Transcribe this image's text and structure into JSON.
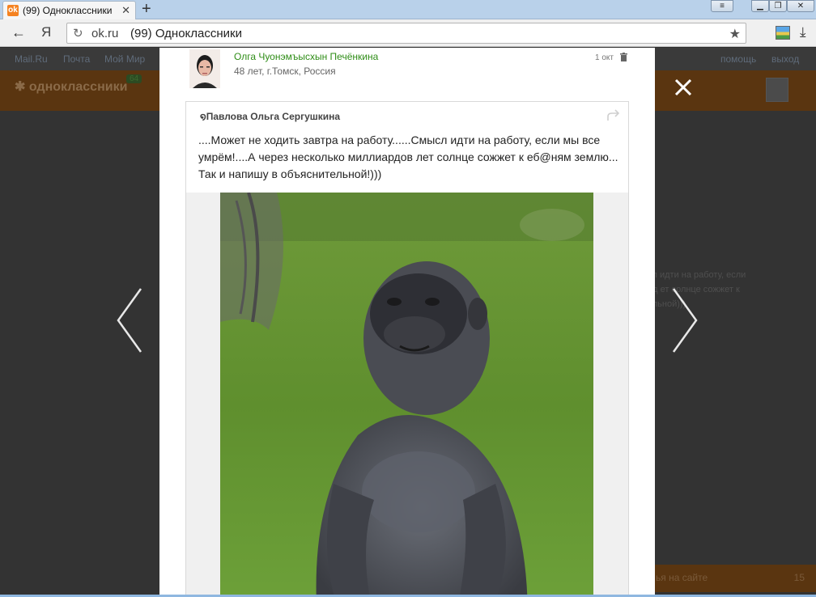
{
  "browser": {
    "tab_title": "(99) Одноклассники",
    "tab_favicon": "ok-favicon",
    "tab_close": "✕",
    "new_tab": "+",
    "address_host": "ok.ru",
    "address_title": "(99) Одноклассники",
    "back_glyph": "←",
    "yandex_glyph": "Я",
    "reload_glyph": "↻",
    "star_glyph": "★",
    "download_glyph": "⤓"
  },
  "background_page": {
    "top_links": [
      "Mail.Ru",
      "Почта",
      "Мой Мир"
    ],
    "right_links": [
      "помощь",
      "выход"
    ],
    "logo_text": "одноклассники",
    "badge_count": "64",
    "snippet_lines": [
      "сл идти на работу, если",
      "ад ет солнце сожжет к",
      "ельной)))"
    ],
    "bottom_bar_text": "ья на сайте",
    "bottom_bar_count": "15"
  },
  "post": {
    "author_name": "Олга Чуонэмъысхын Печёнкина",
    "author_meta": "48 лет, г.Томск, Россия",
    "date": "1 окт",
    "repost_author": "Павлова Ольга Сергушкина",
    "text": "....Может не ходить завтра на работу......Смысл идти на работу, если мы все умрём!....А через несколько миллиардов лет солнце сожжет к еб@ням землю... Так и напишу в объяснительной!)))",
    "image_subject": "gorilla"
  },
  "colors": {
    "author_green": "#2f8d17",
    "ok_orange": "#f58220",
    "overlay": "#2f2f2f"
  }
}
